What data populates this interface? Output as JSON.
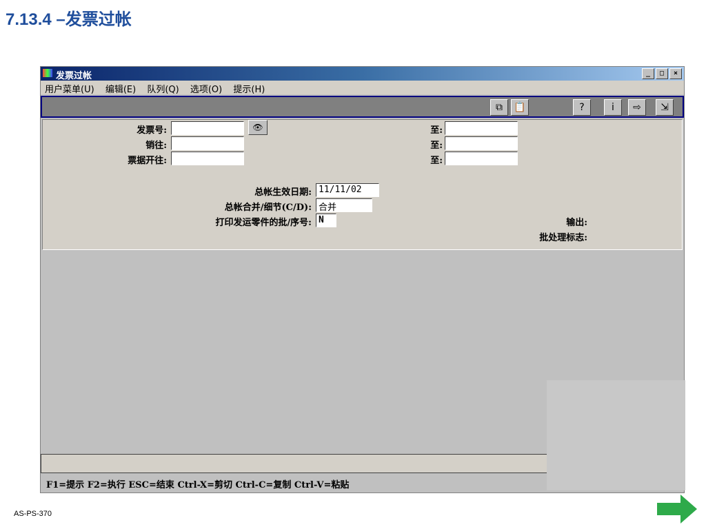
{
  "slide": {
    "title": "7.13.4 –发票过帐",
    "footer": "AS-PS-370"
  },
  "window": {
    "title": "发票过帐",
    "controls": {
      "minimize": "_",
      "maximize": "□",
      "close": "×"
    }
  },
  "menu": [
    "用户菜单(U)",
    "编辑(E)",
    "队列(Q)",
    "选项(O)",
    "提示(H)"
  ],
  "toolbar": {
    "icons": [
      "copy-icon",
      "paste-icon",
      "prompt-help-icon",
      "info-icon",
      "next-icon",
      "exit-icon"
    ]
  },
  "form": {
    "invoice_label": "发票号:",
    "sold_to_label": "销往:",
    "bill_to_label": "票据开往:",
    "to_label": "至:",
    "gl_date_label": "总帐生效日期:",
    "gl_date_value": "11/11/02",
    "summary_label": "总帐合并/细节(C/D):",
    "summary_value": "合并",
    "print_lot_label": "打印发运零件的批/序号:",
    "print_lot_value": "N",
    "output_label": "输出:",
    "batch_label": "批处理标志:"
  },
  "hint_bar": "F1=提示 F2=执行 ESC=结束 Ctrl-X=剪切 Ctrl-C=复制 Ctrl-V=粘贴",
  "colors": {
    "title_blue": "#1f4e9c",
    "next_arrow": "#2eaa4a"
  }
}
